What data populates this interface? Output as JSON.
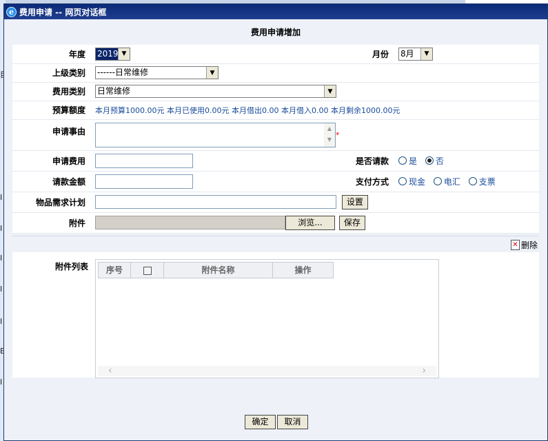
{
  "window": {
    "title": "费用申请 -- 网页对话框",
    "icon": "ie-icon"
  },
  "page": {
    "heading": "费用申请增加"
  },
  "form": {
    "year": {
      "label": "年度",
      "value": "2019"
    },
    "month": {
      "label": "月份",
      "value": "8月"
    },
    "parent_category": {
      "label": "上级类别",
      "value": "------日常维修"
    },
    "category": {
      "label": "费用类别",
      "value": "日常维修"
    },
    "budget": {
      "label": "预算额度",
      "text": "本月预算1000.00元 本月已使用0.00元 本月借出0.00 本月借入0.00 本月剩余1000.00元"
    },
    "reason": {
      "label": "申请事由",
      "value": "",
      "required_mark": "*"
    },
    "amount": {
      "label": "申请费用",
      "value": ""
    },
    "request_payment": {
      "label": "是否请款",
      "options": [
        "是",
        "否"
      ],
      "selected": "否"
    },
    "payment_amount": {
      "label": "请款金额",
      "value": ""
    },
    "payment_method": {
      "label": "支付方式",
      "options": [
        "现金",
        "电汇",
        "支票"
      ],
      "selected": ""
    },
    "plan": {
      "label": "物品需求计划",
      "value": "",
      "button": "设置"
    },
    "attachment": {
      "label": "附件",
      "browse_button": "浏览...",
      "save_button": "保存"
    }
  },
  "delete_link": "删除",
  "attachments": {
    "label": "附件列表",
    "columns": [
      "序号",
      "",
      "附件名称",
      "操作"
    ],
    "rows": []
  },
  "footer": {
    "ok": "确定",
    "cancel": "取消"
  },
  "background": {
    "side_letters": [
      "目",
      "I",
      "I",
      "I",
      "I",
      "I",
      "I",
      "E",
      "I"
    ]
  }
}
